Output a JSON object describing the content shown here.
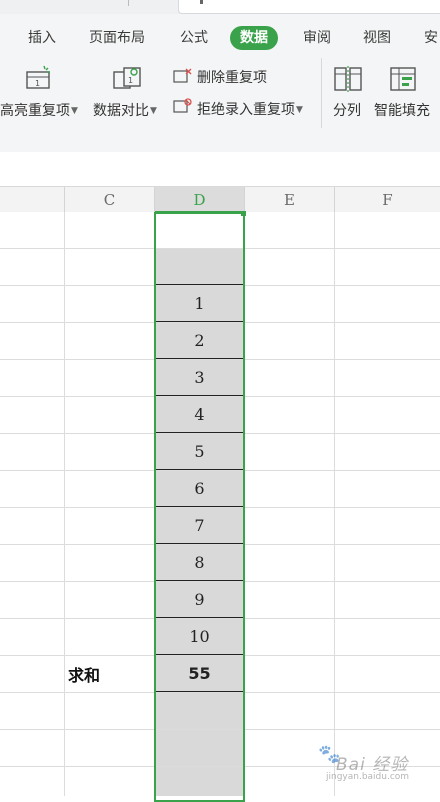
{
  "menu": {
    "tabs": [
      {
        "label": "插入"
      },
      {
        "label": "页面布局"
      },
      {
        "label": "公式"
      },
      {
        "label": "数据",
        "active": true
      },
      {
        "label": "审阅"
      },
      {
        "label": "视图"
      },
      {
        "label": "安"
      }
    ]
  },
  "ribbon": {
    "highlight_duplicates": "高亮重复项",
    "compare_data": "数据对比",
    "remove_duplicates": "删除重复项",
    "reject_duplicates": "拒绝录入重复项",
    "split_column": "分列",
    "smart_fill": "智能填充"
  },
  "sheet": {
    "columns": [
      "C",
      "D",
      "E",
      "F"
    ],
    "selected_column": "D",
    "d_values": [
      "",
      "",
      "1",
      "2",
      "3",
      "4",
      "5",
      "6",
      "7",
      "8",
      "9",
      "10",
      "55",
      "",
      "",
      ""
    ],
    "sum_label": "求和"
  },
  "watermark": {
    "brand": "Bai 经验",
    "url": "jingyan.baidu.com"
  },
  "colors": {
    "accent": "#3aa24a",
    "selected_fill": "#d9d9d9"
  }
}
